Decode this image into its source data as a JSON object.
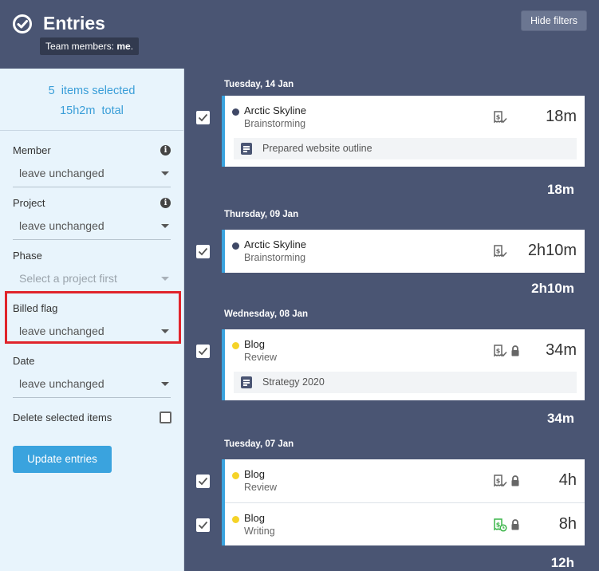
{
  "header": {
    "title": "Entries",
    "team_prefix": "Team members: ",
    "team_value": "me",
    "team_suffix": ".",
    "hide_filters_label": "Hide filters"
  },
  "sidebar": {
    "selected_line": "5  items selected",
    "total_line": "15h2m  total",
    "fields": {
      "member": {
        "label": "Member",
        "value": "leave unchanged"
      },
      "project": {
        "label": "Project",
        "value": "leave unchanged"
      },
      "phase": {
        "label": "Phase",
        "value": "Select a project first"
      },
      "billed": {
        "label": "Billed flag",
        "value": "leave unchanged"
      },
      "date": {
        "label": "Date",
        "value": "leave unchanged"
      }
    },
    "delete_label": "Delete selected items",
    "update_label": "Update entries"
  },
  "days": [
    {
      "label": "Tuesday, 14 Jan",
      "total": "18m",
      "entries": [
        {
          "project": "Arctic Skyline",
          "phase": "Brainstorming",
          "duration": "18m",
          "dot_color": "#3f4866",
          "billed_icon": "billed-check-icon",
          "locked": false,
          "note": "Prepared website outline"
        }
      ]
    },
    {
      "label": "Thursday, 09 Jan",
      "total": "2h10m",
      "entries": [
        {
          "project": "Arctic Skyline",
          "phase": "Brainstorming",
          "duration": "2h10m",
          "dot_color": "#3f4866",
          "billed_icon": "billed-check-icon",
          "locked": false,
          "note": ""
        }
      ]
    },
    {
      "label": "Wednesday, 08 Jan",
      "total": "34m",
      "entries": [
        {
          "project": "Blog",
          "phase": "Review",
          "duration": "34m",
          "dot_color": "#f5d328",
          "billed_icon": "billed-check-icon",
          "locked": true,
          "note": "Strategy 2020"
        }
      ]
    },
    {
      "label": "Tuesday, 07 Jan",
      "total": "12h",
      "entries": [
        {
          "project": "Blog",
          "phase": "Review",
          "duration": "4h",
          "dot_color": "#f5d328",
          "billed_icon": "billed-check-icon",
          "locked": true,
          "note": ""
        },
        {
          "project": "Blog",
          "phase": "Writing",
          "duration": "8h",
          "dot_color": "#f5d328",
          "billed_icon": "billed-pending-icon",
          "locked": true,
          "note": ""
        }
      ]
    }
  ],
  "colors": {
    "accent": "#3aa3de",
    "header_bg": "#4a5573",
    "sidebar_bg": "#e8f4fc",
    "highlight": "#e0242b",
    "billed_pending": "#3cb54a"
  }
}
